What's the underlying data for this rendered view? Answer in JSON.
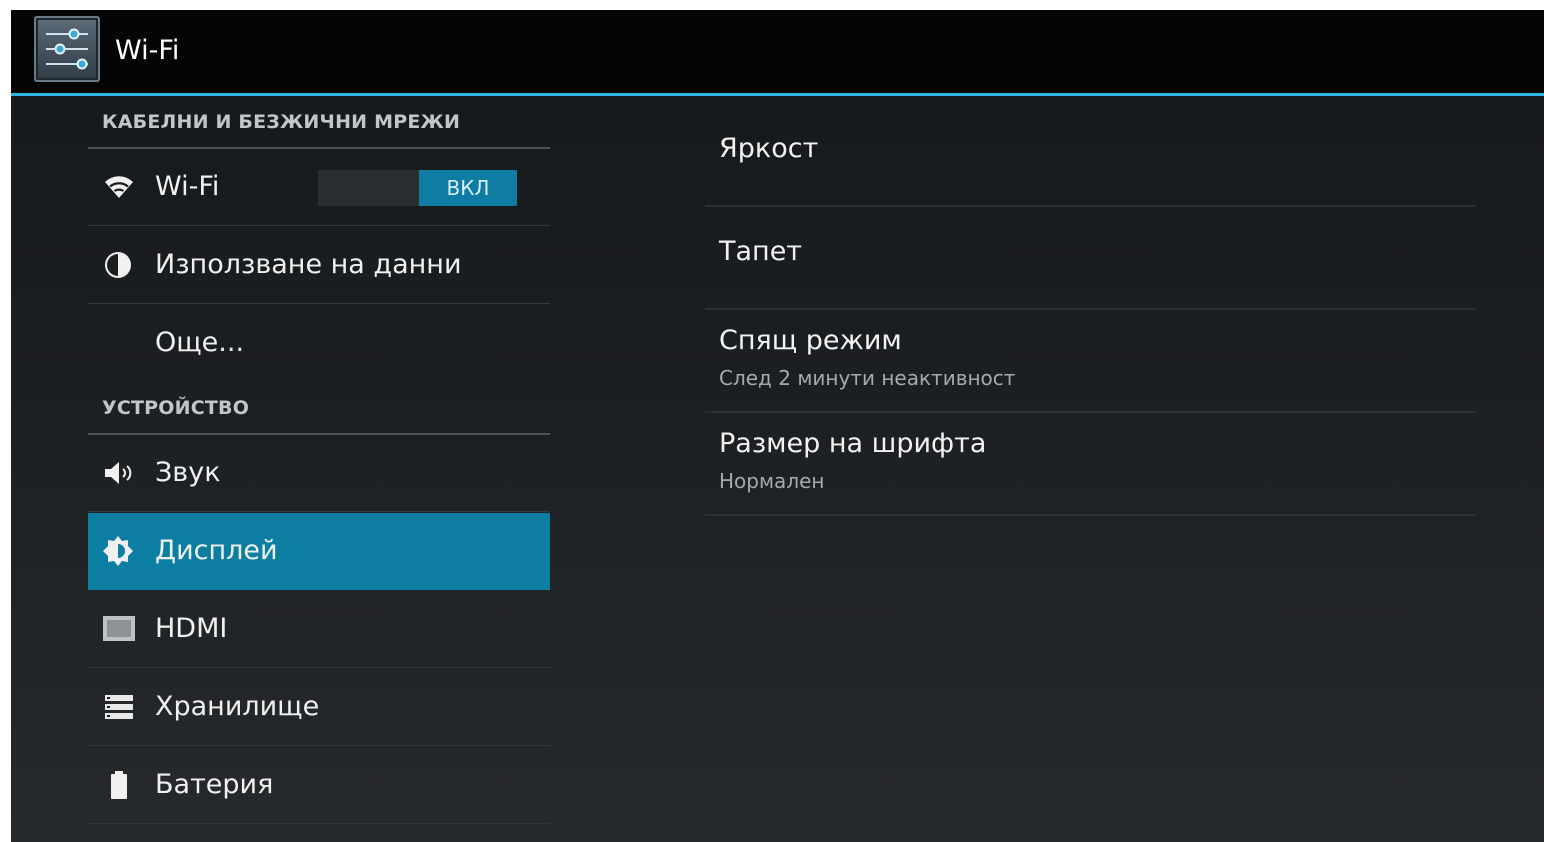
{
  "actionbar": {
    "app_icon": "settings-sliders-icon",
    "title": "Wi-Fi"
  },
  "left": {
    "sections": [
      {
        "header": "КАБЕЛНИ И БЕЗЖИЧНИ МРЕЖИ",
        "items": [
          {
            "label": "Wi-Fi",
            "icon": "wifi-icon",
            "toggle": "ВКЛ"
          },
          {
            "label": "Използване на данни",
            "icon": "data-usage-icon"
          },
          {
            "label": "Още...",
            "icon": ""
          }
        ]
      },
      {
        "header": "УСТРОЙСТВО",
        "items": [
          {
            "label": "Звук",
            "icon": "speaker-icon"
          },
          {
            "label": "Дисплей",
            "icon": "brightness-icon",
            "selected": true
          },
          {
            "label": "HDMI",
            "icon": "hdmi-icon"
          },
          {
            "label": "Хранилище",
            "icon": "storage-icon"
          },
          {
            "label": "Батерия",
            "icon": "battery-icon"
          }
        ]
      }
    ]
  },
  "right": {
    "prefs": [
      {
        "title": "Яркост",
        "summary": ""
      },
      {
        "title": "Тапет",
        "summary": ""
      },
      {
        "title": "Спящ режим",
        "summary": "След 2 минути неактивност"
      },
      {
        "title": "Размер на шрифта",
        "summary": "Нормален"
      }
    ]
  },
  "colors": {
    "accent": "#33b5e5",
    "selected": "#0b7ea2",
    "toggle_on": "#0e7ca3"
  }
}
